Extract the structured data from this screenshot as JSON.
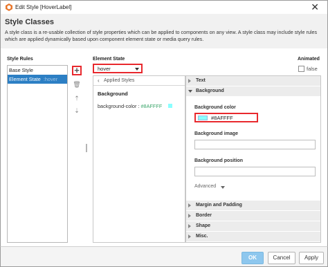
{
  "window": {
    "title": "Edit Style [HoverLabel]",
    "close_label": "✕"
  },
  "header": {
    "title": "Style Classes",
    "description": "A style class is a re-usable collection of style properties which can be applied to components on any view. A style class may include style rules which are applied dynamically based upon component element state or media query rules."
  },
  "style_rules": {
    "label": "Style Rules",
    "items": [
      {
        "label": "Base Style",
        "suffix": ""
      },
      {
        "label": "Element State",
        "suffix": ":hover"
      }
    ]
  },
  "toolbar": {
    "add": "+",
    "delete": "🗑",
    "up": "⇡",
    "down": "⇣"
  },
  "element_state": {
    "label": "Element State",
    "value": "hover"
  },
  "animated": {
    "label": "Animated",
    "value": "false"
  },
  "applied_styles": {
    "back_label": "Applied Styles",
    "section": "Background",
    "property": "background-color",
    "separator": " : ",
    "value": "#8AFFFF",
    "swatch_color": "#8AFFFF"
  },
  "properties": {
    "sections": {
      "text": "Text",
      "background": "Background",
      "margin": "Margin and Padding",
      "border": "Border",
      "shape": "Shape",
      "misc": "Misc."
    },
    "background_color": {
      "label": "Background color",
      "value": "#8AFFFF"
    },
    "background_image": {
      "label": "Background image",
      "value": ""
    },
    "background_position": {
      "label": "Background position",
      "value": ""
    },
    "advanced_label": "Advanced"
  },
  "footer": {
    "ok": "OK",
    "cancel": "Cancel",
    "apply": "Apply"
  },
  "colors": {
    "accent": "#2c7fc4",
    "highlight": "#e8282d",
    "swatch": "#8AFFFF"
  }
}
